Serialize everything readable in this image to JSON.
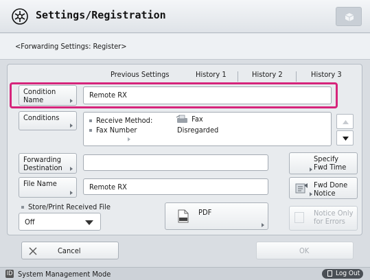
{
  "header": {
    "title": "Settings/Registration",
    "icon": "settings-registration-icon"
  },
  "subheader": {
    "text": "<Forwarding Settings: Register>"
  },
  "tabs": {
    "previous_label": "Previous Settings",
    "history1": "History 1",
    "history2": "History 2",
    "history3": "History 3"
  },
  "condition_name": {
    "button_line1": "Condition",
    "button_line2": "Name",
    "value": "Remote RX"
  },
  "conditions": {
    "button_label": "Conditions",
    "rows": [
      {
        "label": "Receive Method:",
        "value": "Fax"
      },
      {
        "label": "Fax Number",
        "value": "Disregarded"
      }
    ]
  },
  "forwarding_destination": {
    "line1": "Forwarding",
    "line2": "Destination",
    "value": ""
  },
  "specify_fwd_time": {
    "line1": "Specify",
    "line2": "Fwd Time"
  },
  "file_name": {
    "button_label": "File Name",
    "value": "Remote RX"
  },
  "fwd_done_notice": {
    "line1": "Fwd Done",
    "line2": "Notice"
  },
  "store_print": {
    "label": "Store/Print Received File",
    "value": "Off"
  },
  "pdf_button": {
    "label": "PDF"
  },
  "notice_errors": {
    "line1": "Notice Only",
    "line2": "for Errors"
  },
  "cancel_button": {
    "label": "Cancel"
  },
  "ok_button": {
    "label": "OK"
  },
  "status": {
    "mode": "System Management Mode",
    "logout": "Log Out"
  },
  "colors": {
    "highlight": "#d6247b",
    "logout_bg": "#4a4f55"
  }
}
